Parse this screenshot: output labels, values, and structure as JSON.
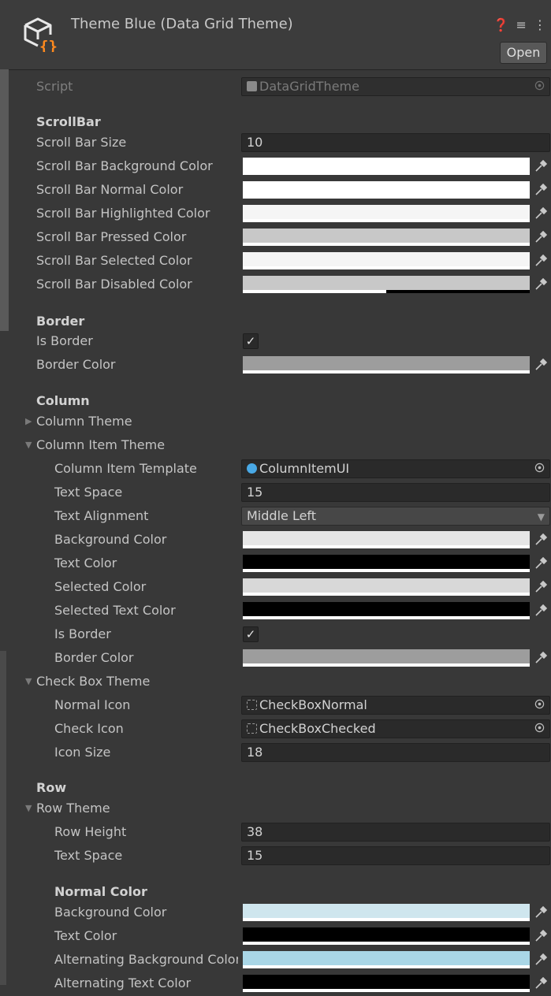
{
  "header": {
    "title": "Theme Blue (Data Grid Theme)",
    "tools": "❓ ≡ ⋮",
    "open_label": "Open",
    "asset_icon": "scriptable-object-icon"
  },
  "script": {
    "label": "Script",
    "value": "DataGridTheme"
  },
  "scrollbar": {
    "header": "ScrollBar",
    "size_label": "Scroll Bar Size",
    "size_value": "10",
    "background_label": "Scroll Bar Background Color",
    "normal_label": "Scroll Bar Normal Color",
    "highlighted_label": "Scroll Bar Highlighted Color",
    "pressed_label": "Scroll Bar Pressed Color",
    "selected_label": "Scroll Bar Selected Color",
    "disabled_label": "Scroll Bar Disabled Color"
  },
  "border": {
    "header": "Border",
    "is_border_label": "Is Border",
    "border_color_label": "Border Color"
  },
  "column": {
    "header": "Column",
    "column_theme": "Column Theme",
    "item_theme": "Column Item Theme",
    "item_template_label": "Column Item Template",
    "item_template_value": "ColumnItemUI",
    "text_space_label": "Text Space",
    "text_space_value": "15",
    "text_alignment_label": "Text Alignment",
    "text_alignment_value": "Middle Left",
    "background_label": "Background Color",
    "text_color_label": "Text Color",
    "selected_label": "Selected Color",
    "selected_text_label": "Selected Text Color",
    "is_border_label": "Is Border",
    "border_color_label": "Border Color"
  },
  "checkbox": {
    "header": "Check Box Theme",
    "normal_label": "Normal Icon",
    "normal_value": "CheckBoxNormal",
    "check_label": "Check Icon",
    "check_value": "CheckBoxChecked",
    "size_label": "Icon Size",
    "size_value": "18"
  },
  "row": {
    "header": "Row",
    "theme": "Row Theme",
    "height_label": "Row Height",
    "height_value": "38",
    "text_space_label": "Text Space",
    "text_space_value": "15",
    "normal_header": "Normal Color",
    "background_label": "Background Color",
    "text_color_label": "Text Color",
    "alt_background_label": "Alternating Background Color",
    "alt_text_label": "Alternating Text Color"
  },
  "colors": {
    "scroll_background": "#ffffff",
    "scroll_normal": "#ffffff",
    "scroll_highlighted": "#f5f5f5",
    "scroll_pressed": "#c8c8c8",
    "scroll_selected": "#f5f5f5",
    "scroll_disabled": "#c8c8c8",
    "border": "#9d9d9d",
    "col_background": "#e6e6e6",
    "col_text": "#000000",
    "col_selected": "#d8d8d8",
    "col_selected_text": "#000000",
    "col_border": "#9d9d9d",
    "row_background": "#cfe6ee",
    "row_text": "#000000",
    "row_alt_background": "#a9d6e6",
    "row_alt_text": "#000000"
  }
}
